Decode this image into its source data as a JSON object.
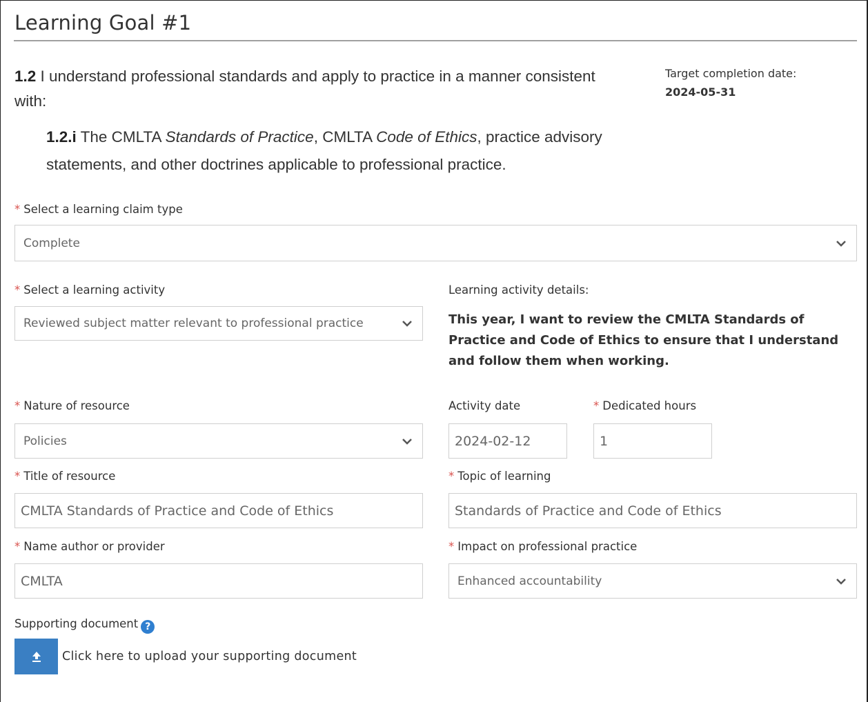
{
  "goal": {
    "title": "Learning Goal #1"
  },
  "standard": {
    "main_num": "1.2",
    "main_text": " I understand professional standards and apply to practice in a manner consistent with:",
    "sub_num": "1.2.i",
    "sub_text_1": " The CMLTA ",
    "sub_italic_1": "Standards of Practice",
    "sub_text_2": ", CMLTA ",
    "sub_italic_2": "Code of Ethics",
    "sub_text_3": ", practice advisory statements, and other doctrines applicable to professional practice."
  },
  "target": {
    "label": "Target completion date:",
    "value": "2024-05-31"
  },
  "required_marker": "*",
  "claim_type": {
    "label": "Select a learning claim type",
    "value": "Complete"
  },
  "activity": {
    "label": "Select a learning activity",
    "value": "Reviewed subject matter relevant to professional practice"
  },
  "details": {
    "label": "Learning activity details:",
    "text": "This year, I want to review the CMLTA Standards of Practice and Code of Ethics to ensure that I understand and follow them when working."
  },
  "nature": {
    "label": "Nature of resource",
    "value": "Policies"
  },
  "activity_date": {
    "label": "Activity date",
    "value": "2024-02-12"
  },
  "hours": {
    "label": "Dedicated hours",
    "value": "1"
  },
  "title_resource": {
    "label": "Title of resource",
    "value": "CMLTA Standards of Practice and Code of Ethics"
  },
  "topic": {
    "label": "Topic of learning",
    "value": "Standards of Practice and Code of Ethics"
  },
  "author": {
    "label": "Name author or provider",
    "value": "CMLTA"
  },
  "impact": {
    "label": "Impact on professional practice",
    "value": "Enhanced accountability"
  },
  "supporting": {
    "label": "Supporting document",
    "help_icon": "question-circle-icon",
    "upload_icon": "upload-icon",
    "upload_text": "Click here to upload your supporting document"
  },
  "colors": {
    "accent": "#3a7fc3",
    "required": "#d9534f",
    "help": "#2f7fd0"
  }
}
